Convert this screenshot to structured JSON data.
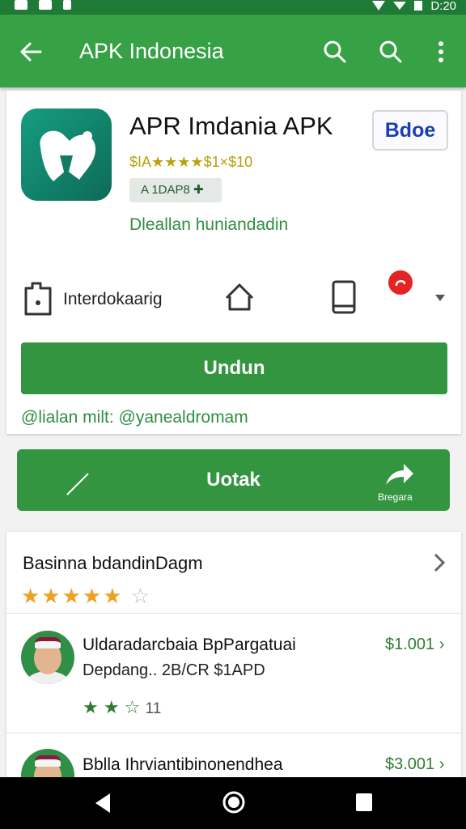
{
  "status_bar": {
    "time": "D:20"
  },
  "app_bar": {
    "title": "APK Indonesia"
  },
  "app": {
    "name": "APR Imdania APK",
    "badge": "Bdoe",
    "rating_line": "$IA★★★★$1×$10",
    "chip": "A 1DAP8 ✚",
    "developer": "Dleallan huniandadin"
  },
  "tools": {
    "install_label": "Interdokaarig"
  },
  "buttons": {
    "primary": "Undun",
    "secondary": "Uotak",
    "share_label": "Bregara"
  },
  "info_line": "@lialan milt: @yanealdromam",
  "reviews": {
    "header": "Basinna bdandinDagm",
    "stars_filled": "★★★★★",
    "stars_empty": "☆",
    "items": [
      {
        "title": "Uldaradarcbaia BpPargatuai",
        "subtitle": "Depdang.. 2B/CR $1APD",
        "price": "$1.001 ›",
        "stars": "★ ★ ☆",
        "count": "11"
      },
      {
        "title": "Bblla Ihrviantibinonendhea",
        "price": "$3.001 ›"
      }
    ]
  },
  "colors": {
    "primary": "#36a145",
    "button": "#33953f",
    "status": "#1e7a34"
  }
}
